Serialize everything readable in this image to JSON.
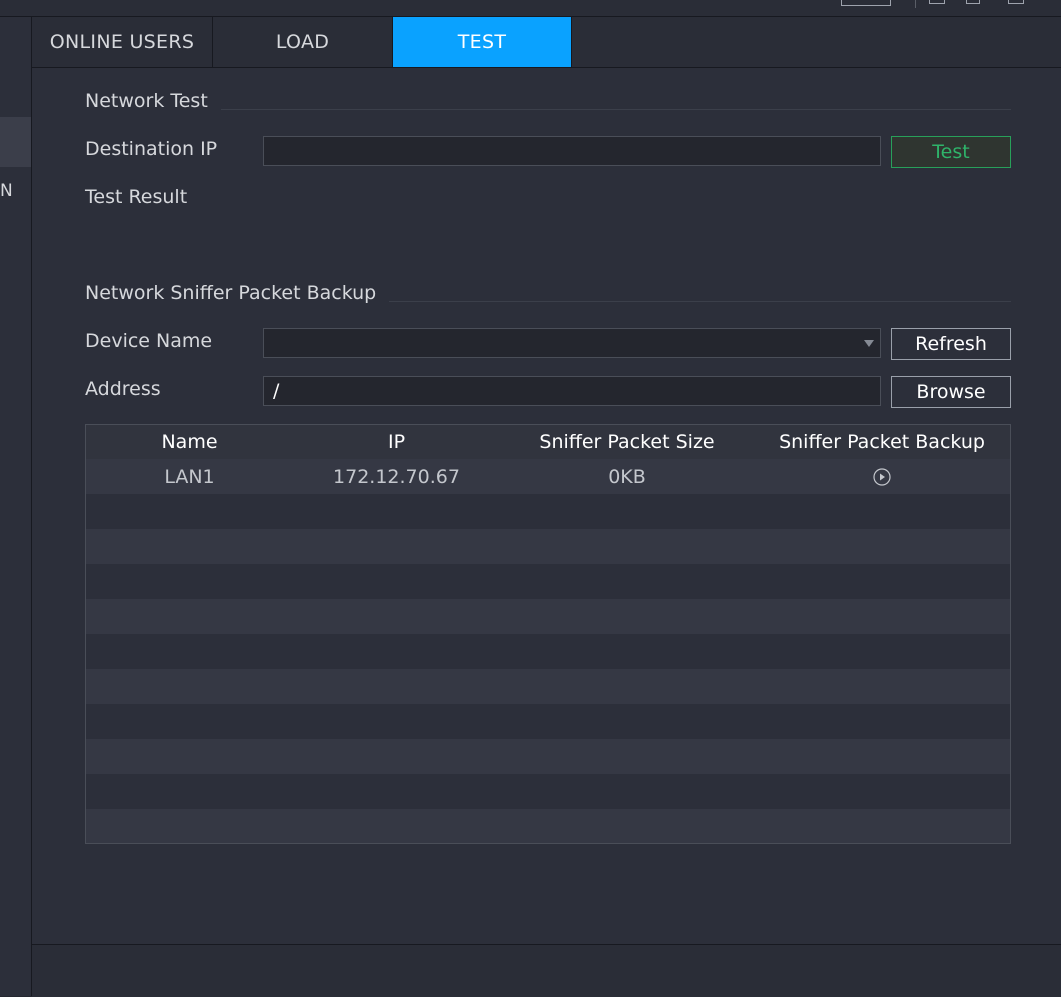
{
  "tabs": [
    {
      "label": "ONLINE USERS",
      "active": false
    },
    {
      "label": "LOAD",
      "active": false
    },
    {
      "label": "TEST",
      "active": true
    }
  ],
  "left_nav": {
    "partial_label": "N"
  },
  "network_test": {
    "title": "Network Test",
    "destination_ip_label": "Destination IP",
    "destination_ip_value": "",
    "test_button": "Test",
    "test_result_label": "Test Result"
  },
  "sniffer": {
    "title": "Network Sniffer Packet Backup",
    "device_name_label": "Device Name",
    "device_name_value": "",
    "refresh_button": "Refresh",
    "address_label": "Address",
    "address_value": "/",
    "browse_button": "Browse"
  },
  "table": {
    "columns": [
      "Name",
      "IP",
      "Sniffer Packet Size",
      "Sniffer Packet Backup"
    ],
    "rows": [
      {
        "name": "LAN1",
        "ip": "172.12.70.67",
        "size": "0KB",
        "backup_icon": "play-circle-icon"
      }
    ]
  },
  "colors": {
    "accent": "#0aa2ff",
    "test_green": "#2fb36a",
    "background": "#2c2f3a"
  }
}
